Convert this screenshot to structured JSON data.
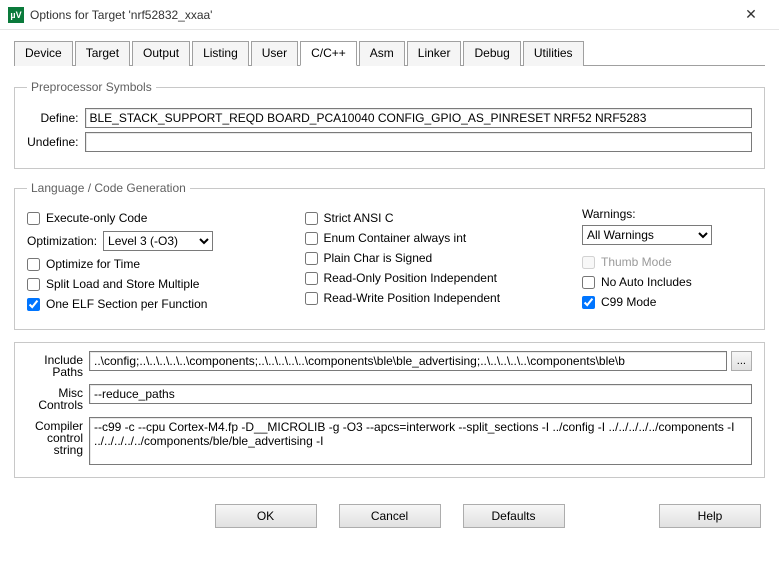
{
  "window": {
    "title": "Options for Target 'nrf52832_xxaa'",
    "icon_text": "µV"
  },
  "tabs": [
    "Device",
    "Target",
    "Output",
    "Listing",
    "User",
    "C/C++",
    "Asm",
    "Linker",
    "Debug",
    "Utilities"
  ],
  "active_tab": 5,
  "preproc": {
    "legend": "Preprocessor Symbols",
    "define_label": "Define:",
    "undefine_label": "Undefine:",
    "define_value": "BLE_STACK_SUPPORT_REQD BOARD_PCA10040 CONFIG_GPIO_AS_PINRESET NRF52 NRF5283",
    "undefine_value": ""
  },
  "langgen": {
    "legend": "Language / Code Generation",
    "left": {
      "execute_only": {
        "label": "Execute-only Code",
        "checked": false
      },
      "optimization_label": "Optimization:",
      "optimization_value": "Level 3 (-O3)",
      "optimize_time": {
        "label": "Optimize for Time",
        "checked": false
      },
      "split_load": {
        "label": "Split Load and Store Multiple",
        "checked": false
      },
      "one_elf": {
        "label": "One ELF Section per Function",
        "checked": true
      }
    },
    "mid": {
      "strict_ansic": {
        "label": "Strict ANSI C",
        "checked": false
      },
      "enum_int": {
        "label": "Enum Container always int",
        "checked": false
      },
      "plain_char": {
        "label": "Plain Char is Signed",
        "checked": false
      },
      "ro_pi": {
        "label": "Read-Only Position Independent",
        "checked": false
      },
      "rw_pi": {
        "label": "Read-Write Position Independent",
        "checked": false
      }
    },
    "right": {
      "warnings_label": "Warnings:",
      "warnings_value": "All Warnings",
      "thumb_mode": {
        "label": "Thumb Mode",
        "checked": false,
        "disabled": true
      },
      "no_auto_inc": {
        "label": "No Auto Includes",
        "checked": false
      },
      "c99_mode": {
        "label": "C99 Mode",
        "checked": true
      }
    }
  },
  "paths": {
    "include_label": "Include\nPaths",
    "include_value": "..\\config;..\\..\\..\\..\\..\\components;..\\..\\..\\..\\..\\components\\ble\\ble_advertising;..\\..\\..\\..\\..\\components\\ble\\b",
    "misc_label": "Misc\nControls",
    "misc_value": "--reduce_paths",
    "compiler_label": "Compiler\ncontrol\nstring",
    "compiler_value": "--c99 -c --cpu Cortex-M4.fp -D__MICROLIB -g -O3 --apcs=interwork --split_sections -I ../config -I ../../../../../components -I ../../../../../components/ble/ble_advertising -I",
    "ellipsis": "..."
  },
  "buttons": {
    "ok": "OK",
    "cancel": "Cancel",
    "defaults": "Defaults",
    "help": "Help"
  }
}
